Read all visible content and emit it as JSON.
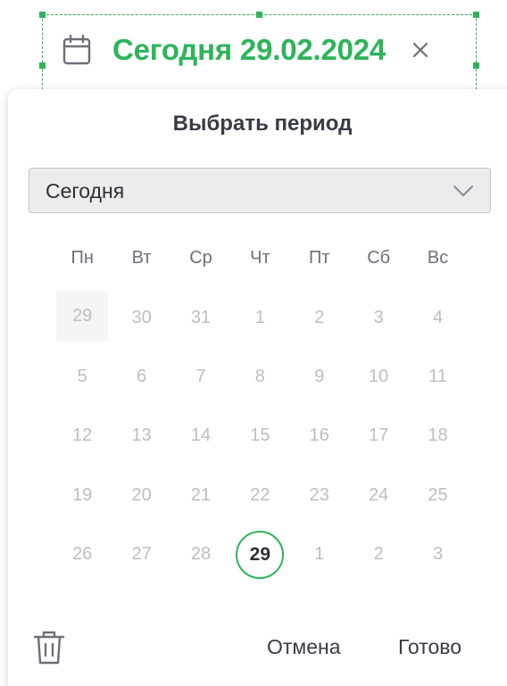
{
  "chip": {
    "label": "Сегодня 29.02.2024",
    "icon": "calendar-icon",
    "clear_icon": "close-icon",
    "accent": "#2db45a"
  },
  "panel": {
    "title": "Выбрать период",
    "select": {
      "value": "Сегодня",
      "icon": "chevron-down-icon"
    },
    "weekdays": [
      "Пн",
      "Вт",
      "Ср",
      "Чт",
      "Пт",
      "Сб",
      "Вс"
    ],
    "days": [
      "29",
      "30",
      "31",
      "1",
      "2",
      "3",
      "4",
      "5",
      "6",
      "7",
      "8",
      "9",
      "10",
      "11",
      "12",
      "13",
      "14",
      "15",
      "16",
      "17",
      "18",
      "19",
      "20",
      "21",
      "22",
      "23",
      "24",
      "25",
      "26",
      "27",
      "28",
      "29",
      "1",
      "2",
      "3"
    ],
    "selected_day": "29",
    "footer": {
      "delete_icon": "trash-icon",
      "cancel_label": "Отмена",
      "done_label": "Готово"
    }
  }
}
